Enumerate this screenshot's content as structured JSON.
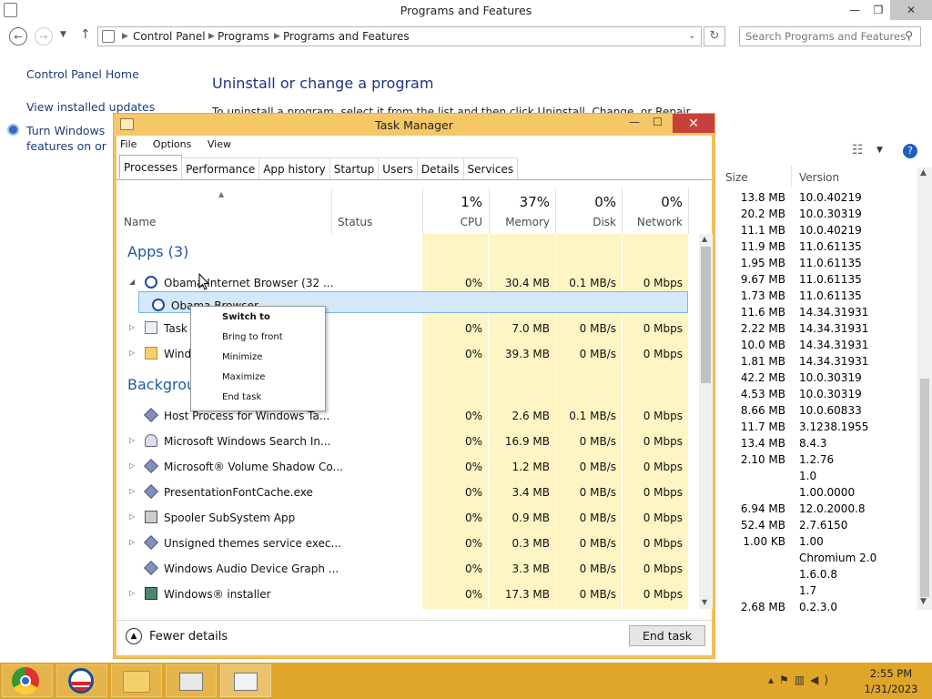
{
  "cp": {
    "title": "Programs and Features",
    "breadcrumb": [
      "Control Panel",
      "Programs",
      "Programs and Features"
    ],
    "search_placeholder": "Search Programs and Features",
    "sidebar": [
      "Control Panel Home",
      "View installed updates",
      "Turn Windows features on or off"
    ],
    "heading": "Uninstall or change a program",
    "description": "To uninstall a program, select it from the list and then click Uninstall, Change, or Repair.",
    "columns": {
      "size": "Size",
      "version": "Version"
    },
    "rows": [
      {
        "size": "13.8 MB",
        "version": "10.0.40219"
      },
      {
        "size": "20.2 MB",
        "version": "10.0.30319"
      },
      {
        "size": "11.1 MB",
        "version": "10.0.40219"
      },
      {
        "size": "11.9 MB",
        "version": "11.0.61135"
      },
      {
        "size": "1.95 MB",
        "version": "11.0.61135"
      },
      {
        "size": "9.67 MB",
        "version": "11.0.61135"
      },
      {
        "size": "1.73 MB",
        "version": "11.0.61135"
      },
      {
        "size": "11.6 MB",
        "version": "14.34.31931"
      },
      {
        "size": "2.22 MB",
        "version": "14.34.31931"
      },
      {
        "size": "10.0 MB",
        "version": "14.34.31931"
      },
      {
        "size": "1.81 MB",
        "version": "14.34.31931"
      },
      {
        "size": "42.2 MB",
        "version": "10.0.30319"
      },
      {
        "size": "4.53 MB",
        "version": "10.0.30319"
      },
      {
        "size": "8.66 MB",
        "version": "10.0.60833"
      },
      {
        "size": "11.7 MB",
        "version": "3.1238.1955"
      },
      {
        "size": "13.4 MB",
        "version": "8.4.3"
      },
      {
        "size": "2.10 MB",
        "version": "1.2.76"
      },
      {
        "size": "",
        "version": "1.0"
      },
      {
        "size": "",
        "version": "1.00.0000"
      },
      {
        "size": "6.94 MB",
        "version": "12.0.2000.8"
      },
      {
        "size": "52.4 MB",
        "version": "2.7.6150"
      },
      {
        "size": "1.00 KB",
        "version": "1.00"
      },
      {
        "size": "",
        "version": "Chromium 2.0"
      },
      {
        "size": "",
        "version": "1.6.0.8"
      },
      {
        "size": "",
        "version": "1.7"
      },
      {
        "size": "2.68 MB",
        "version": "0.2.3.0"
      }
    ]
  },
  "tm": {
    "title": "Task Manager",
    "menu": [
      "File",
      "Options",
      "View"
    ],
    "tabs": [
      "Processes",
      "Performance",
      "App history",
      "Startup",
      "Users",
      "Details",
      "Services"
    ],
    "headers": {
      "name": "Name",
      "status": "Status",
      "cpu": "CPU",
      "memory": "Memory",
      "disk": "Disk",
      "network": "Network"
    },
    "totals": {
      "cpu": "1%",
      "memory": "37%",
      "disk": "0%",
      "network": "0%"
    },
    "apps_header": "Apps (3)",
    "bg_header": "Background processes",
    "apps": [
      {
        "name": "Obama Internet Browser (32 ...",
        "cpu": "0%",
        "mem": "30.4 MB",
        "disk": "0.1 MB/s",
        "net": "0 Mbps",
        "exp": "◢"
      },
      {
        "name": "Obama Browser",
        "cpu": "",
        "mem": "",
        "disk": "",
        "net": "",
        "exp": ""
      },
      {
        "name": "Task Manager",
        "cpu": "0%",
        "mem": "7.0 MB",
        "disk": "0 MB/s",
        "net": "0 Mbps",
        "exp": "▷"
      },
      {
        "name": "Windows Explorer",
        "cpu": "0%",
        "mem": "39.3 MB",
        "disk": "0 MB/s",
        "net": "0 Mbps",
        "exp": "▷"
      }
    ],
    "bg": [
      {
        "name": "Host Process for Windows Ta...",
        "cpu": "0%",
        "mem": "2.6 MB",
        "disk": "0.1 MB/s",
        "net": "0 Mbps",
        "exp": ""
      },
      {
        "name": "Microsoft Windows Search In...",
        "cpu": "0%",
        "mem": "16.9 MB",
        "disk": "0 MB/s",
        "net": "0 Mbps",
        "exp": "▷"
      },
      {
        "name": "Microsoft® Volume Shadow Co...",
        "cpu": "0%",
        "mem": "1.2 MB",
        "disk": "0 MB/s",
        "net": "0 Mbps",
        "exp": "▷"
      },
      {
        "name": "PresentationFontCache.exe",
        "cpu": "0%",
        "mem": "3.4 MB",
        "disk": "0 MB/s",
        "net": "0 Mbps",
        "exp": "▷"
      },
      {
        "name": "Spooler SubSystem App",
        "cpu": "0%",
        "mem": "0.9 MB",
        "disk": "0 MB/s",
        "net": "0 Mbps",
        "exp": "▷"
      },
      {
        "name": "Unsigned themes service exec...",
        "cpu": "0%",
        "mem": "0.3 MB",
        "disk": "0 MB/s",
        "net": "0 Mbps",
        "exp": "▷"
      },
      {
        "name": "Windows Audio Device Graph ...",
        "cpu": "0%",
        "mem": "3.3 MB",
        "disk": "0 MB/s",
        "net": "0 Mbps",
        "exp": ""
      },
      {
        "name": "Windows® installer",
        "cpu": "0%",
        "mem": "17.3 MB",
        "disk": "0 MB/s",
        "net": "0 Mbps",
        "exp": "▷"
      }
    ],
    "fewer_details": "Fewer details",
    "end_task": "End task"
  },
  "context_menu": [
    "Switch to",
    "Bring to front",
    "Minimize",
    "Maximize",
    "End task"
  ],
  "taskbar": {
    "time": "2:55 PM",
    "date": "1/31/2023"
  }
}
